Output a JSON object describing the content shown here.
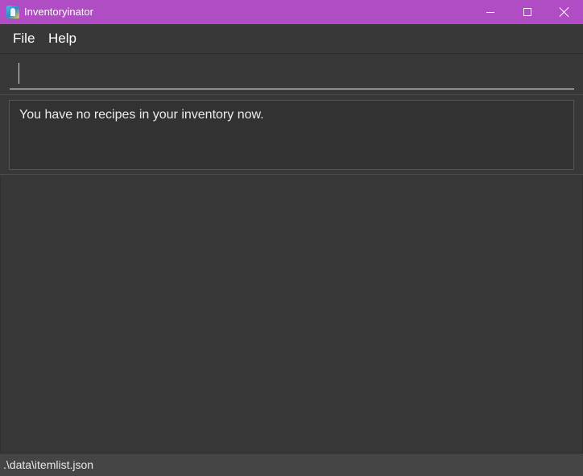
{
  "window": {
    "title": "Inventoryinator",
    "app_icon": "app-logo-icon",
    "title_bar_color": "#b04cc4",
    "controls": [
      "minimize-icon",
      "maximize-icon",
      "close-icon"
    ]
  },
  "menu": {
    "file_label": "File",
    "help_label": "Help"
  },
  "command_box": {
    "value": "",
    "placeholder": ""
  },
  "result_display": {
    "message": "You have no recipes in your inventory now."
  },
  "status_bar": {
    "save_location": ".\\data\\itemlist.json"
  },
  "colors": {
    "background": "#383838",
    "text": "#ffffff",
    "status_bar": "#454545"
  }
}
